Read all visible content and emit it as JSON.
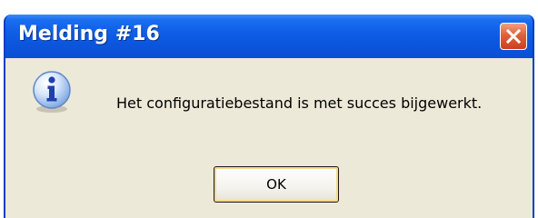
{
  "dialog": {
    "title": "Melding #16",
    "message": "Het configuratiebestand is met succes bijgewerkt.",
    "ok_label": "OK",
    "icon": "info-icon",
    "close_icon": "close-icon"
  },
  "colors": {
    "titlebar": "#0b55dc",
    "client_background": "#ece9d8",
    "close_button": "#e0603a"
  }
}
